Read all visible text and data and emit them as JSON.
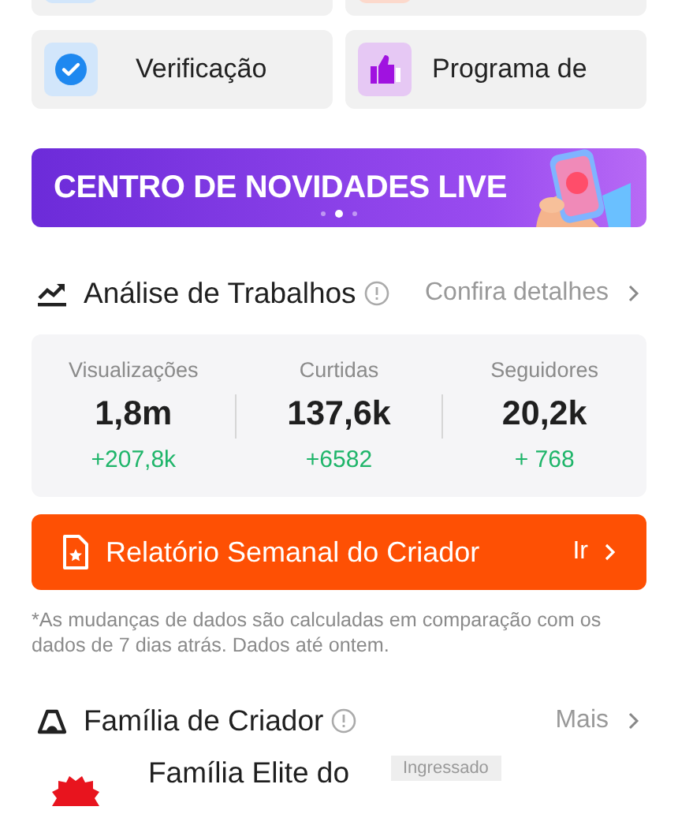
{
  "shortcuts": [
    {
      "label": "Verificação",
      "kind": "verification"
    },
    {
      "label": "Programa de",
      "kind": "program"
    }
  ],
  "banner": {
    "title": "CENTRO DE NOVIDADES LIVE",
    "dots": [
      {
        "selected": false
      },
      {
        "selected": true
      },
      {
        "selected": false
      }
    ]
  },
  "analysis": {
    "title": "Análise de Trabalhos",
    "link": "Confira detalhes",
    "stats": [
      {
        "label": "Visualizações",
        "value": "1,8m",
        "change": "+207,8k"
      },
      {
        "label": "Curtidas",
        "value": "137,6k",
        "change": "+6582"
      },
      {
        "label": "Seguidores",
        "value": "20,2k",
        "change": "+ 768"
      }
    ],
    "report": {
      "label": "Relatório Semanal do Criador",
      "action": "Ir"
    },
    "note": "*As mudanças de dados são calculadas em comparação com os dados de 7 dias atrás. Dados até ontem."
  },
  "family": {
    "title": "Família de Criador",
    "link": "Mais",
    "item": {
      "name": "Família Elite do",
      "badge": "Ingressado"
    }
  }
}
